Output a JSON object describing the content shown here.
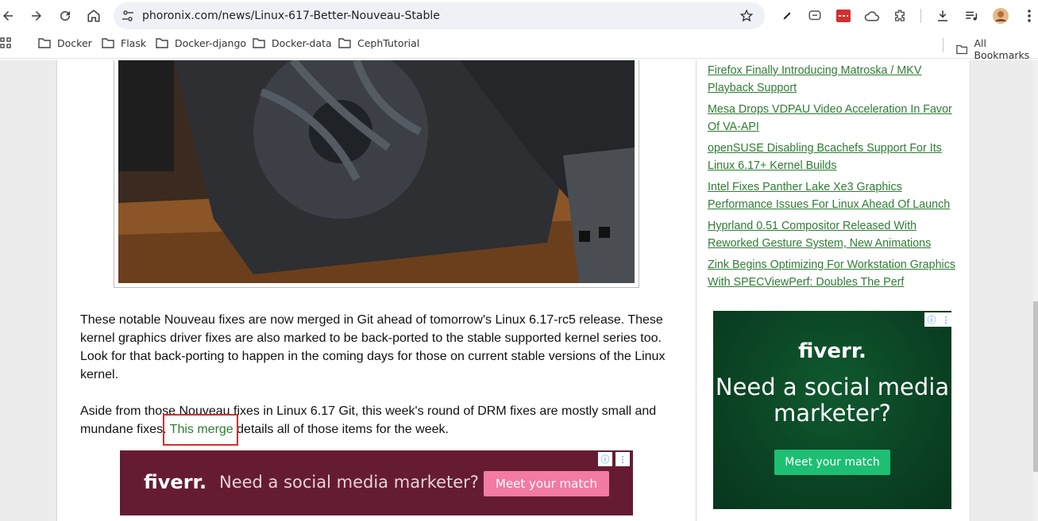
{
  "browser": {
    "url": "phoronix.com/news/Linux-617-Better-Nouveau-Stable",
    "bookmarks": [
      "Docker",
      "Flask",
      "Docker-django",
      "Docker-data",
      "CephTutorial"
    ],
    "all_bookmarks": "All Bookmarks"
  },
  "article": {
    "paragraph1": "These notable Nouveau fixes are now merged in Git ahead of tomorrow's Linux 6.17-rc5 release. These kernel graphics driver fixes are also marked to be back-ported to the stable supported kernel series too. Look for that back-porting to happen in the coming days for those on current stable versions of the Linux kernel.",
    "paragraph2_before": "Aside from those Nouveau fixes in Linux 6.17 Git, this week's round of DRM fixes are mostly small and mundane fixes. ",
    "paragraph2_link": "This merge",
    "paragraph2_after": " details all of those items for the week."
  },
  "banner_ad": {
    "logo": "fiverr.",
    "text": "Need a social media marketer?",
    "cta": "Meet your match"
  },
  "sidebar": {
    "headlines": [
      "Firefox Finally Introducing Matroska / MKV Playback Support",
      "Mesa Drops VDPAU Video Acceleration In Favor Of VA-API",
      "openSUSE Disabling Bcachefs Support For Its Linux 6.17+ Kernel Builds",
      "Intel Fixes Panther Lake Xe3 Graphics Performance Issues For Linux Ahead Of Launch",
      "Hyprland 0.51 Compositor Released With Reworked Gesture System, New Animations",
      "Zink Begins Optimizing For Workstation Graphics With SPECViewPerf: Doubles The Perf"
    ],
    "ad": {
      "logo": "fiverr.",
      "text": "Need a social media marketer?",
      "cta": "Meet your match"
    }
  },
  "colors": {
    "link": "#2e7d32",
    "highlight": "#d32f2f",
    "banner_bg": "#651c32",
    "banner_cta": "#f27aa3",
    "side_ad_bg": "#0b4424",
    "side_ad_cta": "#1dbf73"
  }
}
